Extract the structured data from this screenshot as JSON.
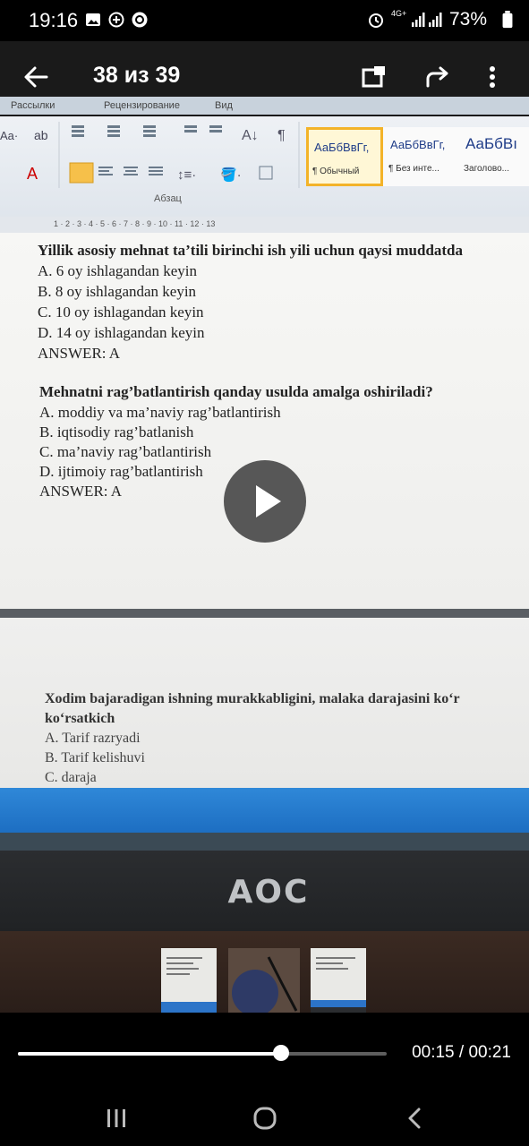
{
  "status_bar": {
    "time": "19:16",
    "network": "4G+",
    "battery": "73%",
    "left_icons": [
      "gallery-icon",
      "message-icon",
      "sync-icon"
    ],
    "right_icons": [
      "alarm-icon",
      "signal-icon",
      "battery-icon"
    ]
  },
  "viewer": {
    "counter": "38 из 39",
    "actions": [
      "back-icon",
      "cast-icon",
      "share-icon",
      "more-icon"
    ]
  },
  "word": {
    "tabs": [
      "Рассылки",
      "Рецензирование",
      "Вид"
    ],
    "group_label": "Абзац",
    "styles": [
      {
        "sample": "АаБбВвГг,",
        "name": "¶ Обычный"
      },
      {
        "sample": "АаБбВвГг,",
        "name": "¶ Без инте..."
      },
      {
        "sample": "АаБбВı",
        "name": "Заголово..."
      }
    ],
    "ruler": "1 · 2 · 3 · 4 · 5 · 6 · 7 · 8 · 9 · 10 · 11 · 12 · 13"
  },
  "document": {
    "q1": "Yillik asosiy mehnat ta’tili birinchi ish yili uchun qaysi muddatda",
    "q1_options": [
      "A. 6 oy ishlagandan keyin",
      "B. 8 oy ishlagandan keyin",
      "C. 10 oy ishlagandan keyin",
      "D. 14 oy ishlagandan keyin"
    ],
    "q1_answer": "ANSWER: A",
    "q2": "Mehnatni rag’batlantirish qanday usulda amalga oshiriladi?",
    "q2_options": [
      "A. moddiy va ma’naviy rag’batlantirish",
      "B. iqtisodiy rag’batlanish",
      "C. ma’naviy rag’batlantirish",
      "D. ijtimoiy rag’batlantirish"
    ],
    "q2_answer": "ANSWER: A",
    "q3": "Xodim bajaradigan ishning murakkabligini, malaka darajasini ko‘r",
    "q3_cont": "ko‘rsatkich",
    "q3_options": [
      "A. Tarif razryadi",
      "B. Tarif kelishuvi",
      "C. daraja"
    ]
  },
  "monitor_brand": "AOC",
  "video": {
    "progress": 0.714,
    "time": "00:15 / 00:21"
  },
  "nav": [
    "recents-icon",
    "home-icon",
    "back-nav-icon"
  ]
}
